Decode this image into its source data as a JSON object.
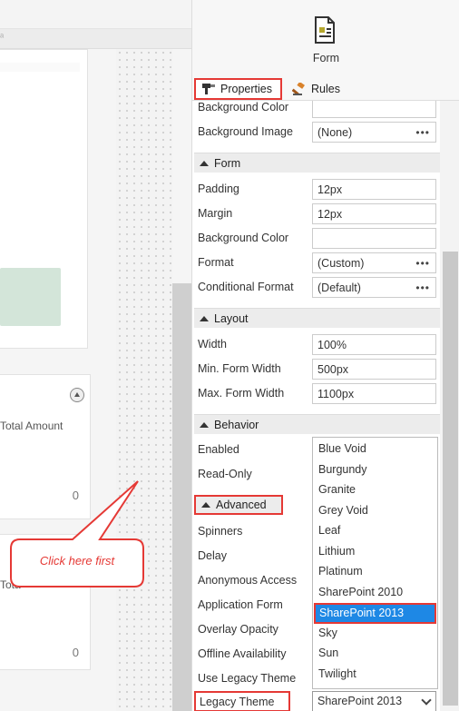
{
  "canvas": {
    "card2_label": "Total Amount",
    "card2_value": "0",
    "card3_label": "Tota",
    "card3_value": "0"
  },
  "callout": {
    "text": "Click here first"
  },
  "panel": {
    "icon_caption": "Form",
    "tabs": [
      {
        "label": "Properties"
      },
      {
        "label": "Rules"
      }
    ],
    "top_rows": [
      {
        "label": "Background Color",
        "value": ""
      },
      {
        "label": "Background Image",
        "value": "(None)"
      }
    ],
    "sections": {
      "form": "Form",
      "layout": "Layout",
      "behavior": "Behavior",
      "advanced": "Advanced"
    },
    "form_rows": [
      {
        "label": "Padding",
        "value": "12px"
      },
      {
        "label": "Margin",
        "value": "12px"
      },
      {
        "label": "Background Color",
        "value": ""
      },
      {
        "label": "Format",
        "value": "(Custom)"
      },
      {
        "label": "Conditional Format",
        "value": "(Default)"
      }
    ],
    "layout_rows": [
      {
        "label": "Width",
        "value": "100%"
      },
      {
        "label": "Min. Form Width",
        "value": "500px"
      },
      {
        "label": "Max. Form Width",
        "value": "1100px"
      }
    ],
    "behavior_rows": [
      {
        "label": "Enabled"
      },
      {
        "label": "Read-Only"
      }
    ],
    "advanced_rows": [
      {
        "label": "Spinners"
      },
      {
        "label": "Delay"
      },
      {
        "label": "Anonymous Access"
      },
      {
        "label": "Application Form"
      },
      {
        "label": "Overlay Opacity"
      },
      {
        "label": "Offline Availability"
      },
      {
        "label": "Use Legacy Theme"
      }
    ],
    "legacy_theme": {
      "label": "Legacy Theme",
      "value": "SharePoint 2013"
    },
    "theme_options": [
      "Blue Void",
      "Burgundy",
      "Granite",
      "Grey Void",
      "Leaf",
      "Lithium",
      "Platinum",
      "SharePoint 2010",
      "SharePoint 2013",
      "Sky",
      "Sun",
      "Twilight"
    ],
    "selected_theme": "SharePoint 2013"
  }
}
